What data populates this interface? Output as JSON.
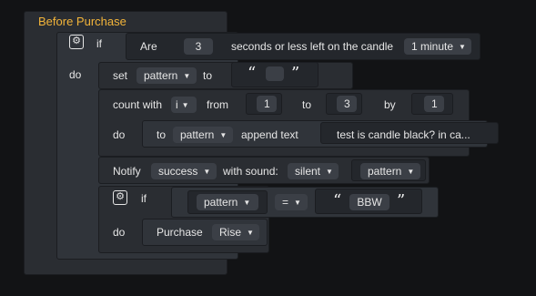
{
  "event": {
    "title": "Before Purchase"
  },
  "if_block": {
    "if_label": "if",
    "do_label": "do",
    "condition": {
      "prefix": "Are",
      "value": "3",
      "suffix": "seconds or less left on the candle",
      "timeframe": "1 minute"
    }
  },
  "set_block": {
    "label": "set",
    "variable": "pattern",
    "to_label": "to",
    "open_quote": "“",
    "close_quote": "”",
    "value": ""
  },
  "count_block": {
    "label": "count with",
    "variable": "i",
    "from_label": "from",
    "from": "1",
    "to_label": "to",
    "to": "3",
    "by_label": "by",
    "by": "1",
    "do_label": "do",
    "inner": {
      "to_label": "to",
      "variable": "pattern",
      "action": "append text",
      "text": "test is candle black? in ca..."
    }
  },
  "notify_block": {
    "label": "Notify",
    "type": "success",
    "sound_label": "with sound:",
    "sound": "silent",
    "variable": "pattern"
  },
  "inner_if": {
    "if_label": "if",
    "do_label": "do",
    "variable": "pattern",
    "operator": "=",
    "open_quote": "“",
    "close_quote": "”",
    "value": "BBW",
    "purchase": {
      "label": "Purchase",
      "direction": "Rise"
    }
  },
  "colors": {
    "background": "#121315",
    "block": "#2a2d32",
    "title": "#f2b43a"
  },
  "icons": {
    "gear": "gear-icon",
    "dropdown": "chevron-down-icon"
  }
}
